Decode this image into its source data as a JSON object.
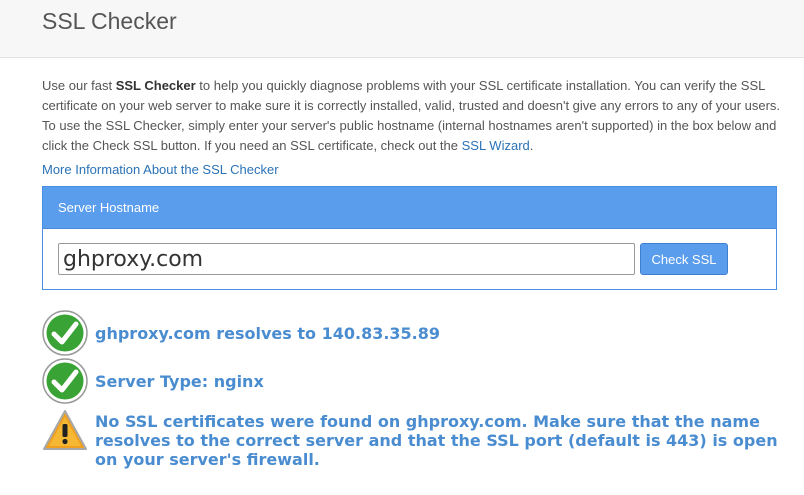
{
  "header": {
    "title": "SSL Checker"
  },
  "intro": {
    "part1": "Use our fast ",
    "bold": "SSL Checker",
    "part2": " to help you quickly diagnose problems with your SSL certificate installation. You can verify the SSL certificate on your web server to make sure it is correctly installed, valid, trusted and doesn't give any errors to any of your users. To use the SSL Checker, simply enter your server's public hostname (internal hostnames aren't supported) in the box below and click the Check SSL button. If you need an SSL certificate, check out the ",
    "wizard_link": "SSL Wizard",
    "part3": "."
  },
  "more_info_link": "More Information About the SSL Checker",
  "form": {
    "panel_title": "Server Hostname",
    "hostname_value": "ghproxy.com",
    "button_label": "Check SSL"
  },
  "results": [
    {
      "icon": "check-icon",
      "text": "ghproxy.com resolves to 140.83.35.89"
    },
    {
      "icon": "check-icon",
      "text": "Server Type: nginx"
    },
    {
      "icon": "warning-icon",
      "text": "No SSL certificates were found on ghproxy.com. Make sure that the name resolves to the correct server and that the SSL port (default is 443) is open on your server's firewall."
    }
  ],
  "colors": {
    "accent": "#5b9ded",
    "link": "#2a72b5",
    "result_text": "#4a8cd0",
    "check_green": "#3aa335",
    "warning_orange": "#f0a020"
  }
}
